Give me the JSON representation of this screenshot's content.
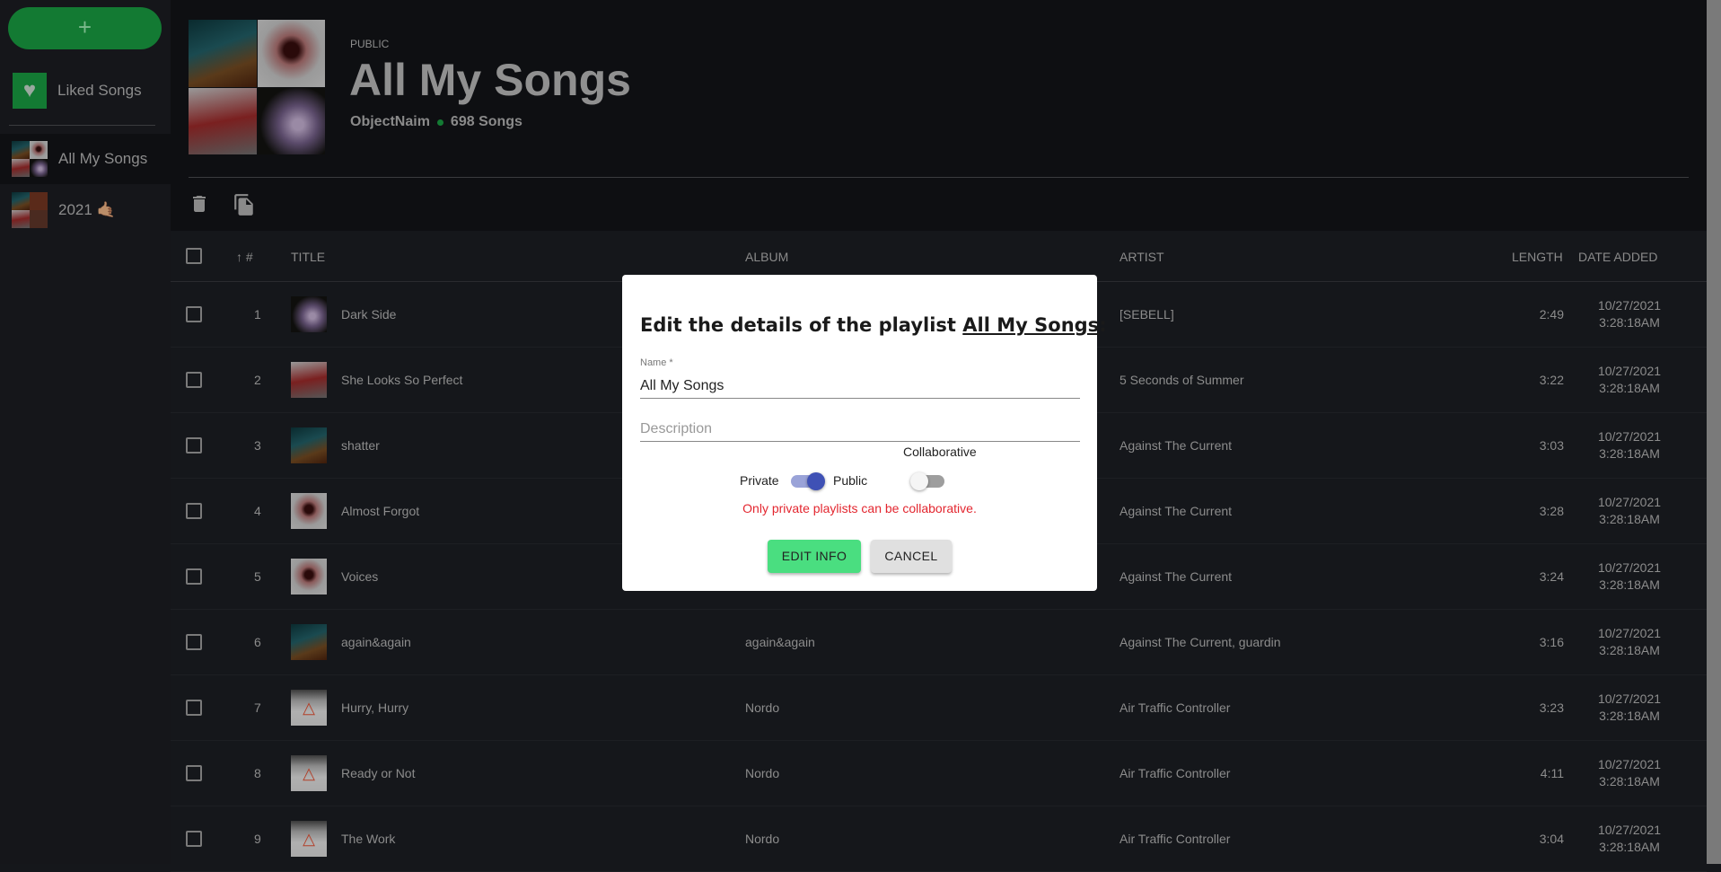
{
  "sidebar": {
    "add_label": "+",
    "liked_label": "Liked Songs",
    "playlists": [
      {
        "label": "All My Songs",
        "active": true
      },
      {
        "label": "2021 🤙🏽",
        "active": false
      }
    ]
  },
  "header": {
    "visibility": "PUBLIC",
    "title": "All My Songs",
    "owner": "ObjectNaim",
    "count": "698 Songs"
  },
  "toolbar": {
    "icons": [
      "trash-icon",
      "copy-icon"
    ]
  },
  "table": {
    "columns": {
      "number": "#",
      "title": "TITLE",
      "album": "ALBUM",
      "artist": "ARTIST",
      "length": "LENGTH",
      "date": "DATE ADDED"
    },
    "rows": [
      {
        "n": "1",
        "title": "Dark Side",
        "album": "",
        "artist": "[SEBELL]",
        "length": "2:49",
        "date": "10/27/2021",
        "time": "3:28:18AM",
        "art": "c4"
      },
      {
        "n": "2",
        "title": "She Looks So Perfect",
        "album": "",
        "artist": "5 Seconds of Summer",
        "length": "3:22",
        "date": "10/27/2021",
        "time": "3:28:18AM",
        "art": "c3b"
      },
      {
        "n": "3",
        "title": "shatter",
        "album": "",
        "artist": "Against The Current",
        "length": "3:03",
        "date": "10/27/2021",
        "time": "3:28:18AM",
        "art": "c1"
      },
      {
        "n": "4",
        "title": "Almost Forgot",
        "album": "",
        "artist": "Against The Current",
        "length": "3:28",
        "date": "10/27/2021",
        "time": "3:28:18AM",
        "art": "c2"
      },
      {
        "n": "5",
        "title": "Voices",
        "album": "",
        "artist": "Against The Current",
        "length": "3:24",
        "date": "10/27/2021",
        "time": "3:28:18AM",
        "art": "c2"
      },
      {
        "n": "6",
        "title": "again&again",
        "album": "again&again",
        "artist": "Against The Current, guardin",
        "length": "3:16",
        "date": "10/27/2021",
        "time": "3:28:18AM",
        "art": "c1"
      },
      {
        "n": "7",
        "title": "Hurry, Hurry",
        "album": "Nordo",
        "artist": "Air Traffic Controller",
        "length": "3:23",
        "date": "10/27/2021",
        "time": "3:28:18AM",
        "art": "atc"
      },
      {
        "n": "8",
        "title": "Ready or Not",
        "album": "Nordo",
        "artist": "Air Traffic Controller",
        "length": "4:11",
        "date": "10/27/2021",
        "time": "3:28:18AM",
        "art": "atc"
      },
      {
        "n": "9",
        "title": "The Work",
        "album": "Nordo",
        "artist": "Air Traffic Controller",
        "length": "3:04",
        "date": "10/27/2021",
        "time": "3:28:18AM",
        "art": "atc"
      }
    ]
  },
  "dialog": {
    "title_prefix": "Edit the details of the playlist ",
    "title_name": "All My Songs",
    "title_suffix": ":",
    "name_label": "Name *",
    "name_value": "All My Songs",
    "description_placeholder": "Description",
    "collaborative_label": "Collaborative",
    "private_label": "Private",
    "public_label": "Public",
    "public_on": true,
    "collaborative_on": false,
    "error": "Only private playlists can be collaborative.",
    "confirm": "EDIT INFO",
    "cancel": "CANCEL"
  },
  "colors": {
    "brand_green": "#137a33",
    "confirm_green": "#4ade80",
    "switch_blue": "#3f51b5",
    "error_red": "#e3262f"
  }
}
